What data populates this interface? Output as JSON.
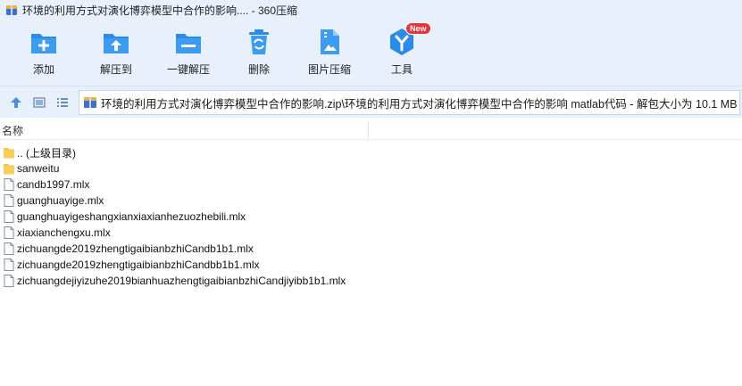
{
  "window": {
    "title": "环境的利用方式对演化博弈模型中合作的影响.... - 360压缩"
  },
  "toolbar": {
    "buttons": [
      {
        "id": "add",
        "label": "添加",
        "icon": "add-archive-icon"
      },
      {
        "id": "extract",
        "label": "解压到",
        "icon": "extract-to-icon"
      },
      {
        "id": "one-click",
        "label": "一键解压",
        "icon": "one-click-extract-icon"
      },
      {
        "id": "delete",
        "label": "删除",
        "icon": "delete-icon"
      },
      {
        "id": "image",
        "label": "图片压缩",
        "icon": "image-compress-icon"
      },
      {
        "id": "tools",
        "label": "工具",
        "icon": "tools-icon",
        "badge": "New"
      }
    ]
  },
  "navbar": {
    "path": "环境的利用方式对演化博弈模型中合作的影响.zip\\环境的利用方式对演化博弈模型中合作的影响 matlab代码 - 解包大小为 10.1 MB"
  },
  "columns": {
    "name": "名称"
  },
  "files": [
    {
      "name": ".. (上级目录)",
      "type": "folder"
    },
    {
      "name": "sanweitu",
      "type": "folder"
    },
    {
      "name": "candb1997.mlx",
      "type": "file"
    },
    {
      "name": "guanghuayige.mlx",
      "type": "file"
    },
    {
      "name": "guanghuayigeshangxianxiaxianhezuozhebili.mlx",
      "type": "file"
    },
    {
      "name": "xiaxianchengxu.mlx",
      "type": "file"
    },
    {
      "name": "zichuangde2019zhengtigaibianbzhiCandb1b1.mlx",
      "type": "file"
    },
    {
      "name": "zichuangde2019zhengtigaibianbzhiCandbb1b1.mlx",
      "type": "file"
    },
    {
      "name": "zichuangdejiyizuhe2019bianhuazhengtigaibianbzhiCandjiyibb1b1.mlx",
      "type": "file"
    }
  ],
  "colors": {
    "accent": "#2a8ce8",
    "header_bg": "#e8f1fb",
    "folder": "#f6c343",
    "badge": "#e8343a"
  }
}
